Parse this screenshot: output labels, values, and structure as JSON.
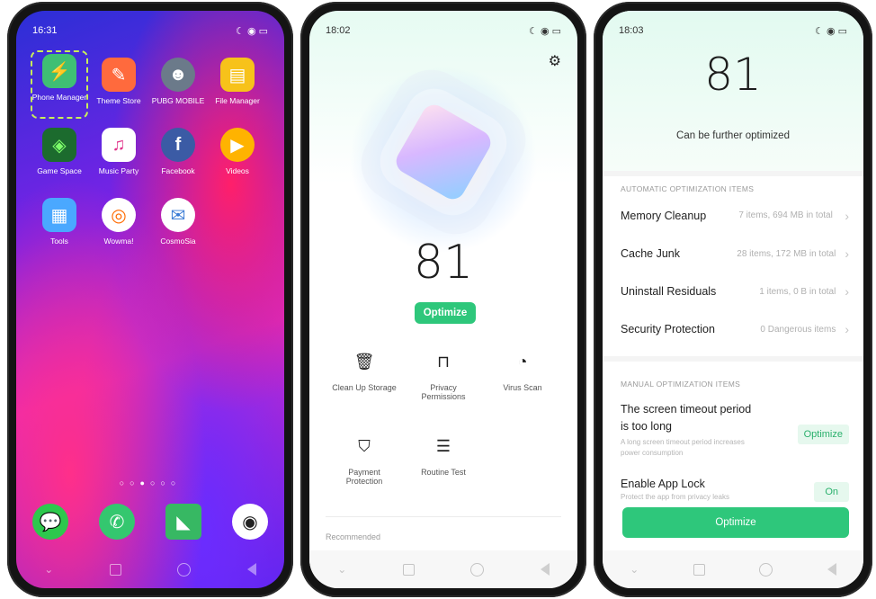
{
  "phone1": {
    "status_time": "16:31",
    "apps": [
      {
        "label": "Phone Manager",
        "icon": "shield-bolt-icon",
        "color": "#3fbf74"
      },
      {
        "label": "Theme Store",
        "icon": "paint-brush-icon",
        "color": "#ff6a3d"
      },
      {
        "label": "PUBG MOBILE",
        "icon": "game-character-icon",
        "color": "#6b7a8a"
      },
      {
        "label": "File Manager",
        "icon": "folder-icon",
        "color": "#f7c21a"
      },
      {
        "label": "Game Space",
        "icon": "game-space-icon",
        "color": "#1c6b2e"
      },
      {
        "label": "Music Party",
        "icon": "music-bars-icon",
        "color": "#ffffff"
      },
      {
        "label": "Facebook",
        "icon": "facebook-icon",
        "color": "#3b5ba5"
      },
      {
        "label": "Videos",
        "icon": "play-icon",
        "color": "#ffb300"
      },
      {
        "label": "Tools",
        "icon": "tools-grid-icon",
        "color": "#4aa8ff"
      },
      {
        "label": "Wowma!",
        "icon": "wowma-icon",
        "color": "#ffffff"
      },
      {
        "label": "CosmoSia",
        "icon": "cosmosia-icon",
        "color": "#ffffff"
      }
    ],
    "dock": [
      {
        "icon": "wechat-icon",
        "color": "#2dc84d"
      },
      {
        "icon": "phone-icon",
        "color": "#34c76f"
      },
      {
        "icon": "message-icon",
        "color": "#37b863"
      },
      {
        "icon": "camera-icon",
        "color": "#ffffff"
      }
    ]
  },
  "phone2": {
    "status_time": "18:02",
    "score": "81",
    "optimize_label": "Optimize",
    "features": [
      {
        "label": "Clean Up Storage",
        "icon": "trash-icon"
      },
      {
        "label": "Privacy Permissions",
        "icon": "privacy-lock-icon"
      },
      {
        "label": "Virus Scan",
        "icon": "scan-gauge-icon"
      },
      {
        "label": "Payment Protection",
        "icon": "shield-icon"
      },
      {
        "label": "Routine Test",
        "icon": "routine-test-icon"
      }
    ],
    "recommended_label": "Recommended"
  },
  "phone3": {
    "status_time": "18:03",
    "score": "81",
    "subtitle": "Can be further optimized",
    "auto_section": "AUTOMATIC OPTIMIZATION ITEMS",
    "auto_items": [
      {
        "label": "Memory Cleanup",
        "value": "7 items, 694 MB in total"
      },
      {
        "label": "Cache Junk",
        "value": "28 items, 172 MB in total"
      },
      {
        "label": "Uninstall Residuals",
        "value": "1 items, 0 B in total"
      },
      {
        "label": "Security Protection",
        "value": "0 Dangerous items"
      }
    ],
    "manual_section": "MANUAL OPTIMIZATION ITEMS",
    "manual_items": [
      {
        "title_line1": "The screen timeout period",
        "title_line2": "is too long",
        "desc": "A long screen timeout period increases power consumption",
        "action": "Optimize"
      },
      {
        "title_line1": "Enable App Lock",
        "desc": "Protect the app from privacy leaks",
        "action": "On"
      }
    ],
    "optimize_label": "Optimize"
  },
  "colors": {
    "accent_green": "#2ec77b"
  }
}
